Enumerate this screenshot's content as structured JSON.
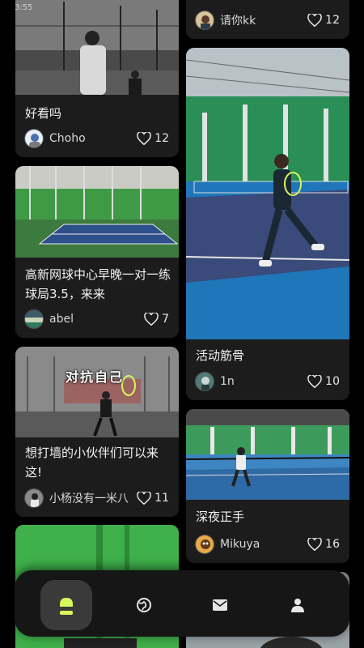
{
  "status_bar": {
    "time": "3:55"
  },
  "left_column": [
    {
      "title": "好看吗",
      "author": "Choho",
      "likes": "12"
    },
    {
      "title": "高新网球中心早晚一对一练球局3.5，来来",
      "author": "abel",
      "likes": "7"
    },
    {
      "image_caption": "对抗自己",
      "title": "想打墙的小伙伴们可以来这!",
      "author": "小杨没有一米八",
      "likes": "11"
    }
  ],
  "right_column": [
    {
      "author": "请你kk",
      "likes": "12"
    },
    {
      "title": "活动筋骨",
      "author": "1n",
      "likes": "10"
    },
    {
      "title": "深夜正手",
      "author": "Mikuya",
      "likes": "16"
    }
  ],
  "tab_bar": {
    "tabs": [
      {
        "icon": "home-icon",
        "active": true
      },
      {
        "icon": "globe-icon",
        "active": false
      },
      {
        "icon": "mail-icon",
        "active": false
      },
      {
        "icon": "profile-icon",
        "active": false
      }
    ]
  },
  "colors": {
    "background": "#000000",
    "card": "#1c1c1c",
    "tab_bar": "#161616",
    "accent": "#d7f75b"
  }
}
